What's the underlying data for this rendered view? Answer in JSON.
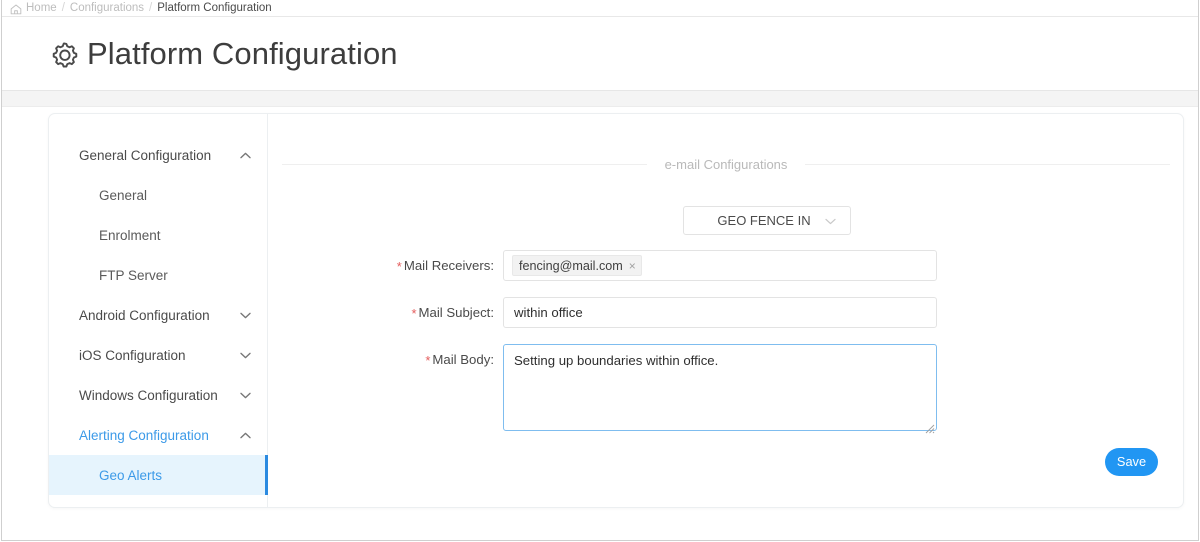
{
  "breadcrumb": {
    "home_icon": "home-icon",
    "items": [
      {
        "label": "Home",
        "current": false
      },
      {
        "label": "Configurations",
        "current": false
      },
      {
        "label": "Platform Configuration",
        "current": true
      }
    ],
    "separator": "/"
  },
  "header": {
    "icon": "gear-icon",
    "title": "Platform Configuration"
  },
  "sidebar": {
    "groups": [
      {
        "label": "General Configuration",
        "expanded": true,
        "chevron": "chevron-up-icon",
        "active": false,
        "children": [
          {
            "label": "General",
            "selected": false
          },
          {
            "label": "Enrolment",
            "selected": false
          },
          {
            "label": "FTP Server",
            "selected": false
          }
        ]
      },
      {
        "label": "Android Configuration",
        "expanded": false,
        "chevron": "chevron-down-icon",
        "active": false,
        "children": []
      },
      {
        "label": "iOS Configuration",
        "expanded": false,
        "chevron": "chevron-down-icon",
        "active": false,
        "children": []
      },
      {
        "label": "Windows Configuration",
        "expanded": false,
        "chevron": "chevron-down-icon",
        "active": false,
        "children": []
      },
      {
        "label": "Alerting Configuration",
        "expanded": true,
        "chevron": "chevron-up-icon",
        "active": true,
        "children": [
          {
            "label": "Geo Alerts",
            "selected": true
          }
        ]
      }
    ]
  },
  "form": {
    "section_title": "e-mail Configurations",
    "fence_select": {
      "value": "GEO FENCE IN",
      "caret_icon": "chevron-down-icon",
      "options": [
        "GEO FENCE IN"
      ]
    },
    "mail_receivers": {
      "label": "Mail Receivers:",
      "required_marker": "*",
      "tags": [
        {
          "value": "fencing@mail.com",
          "remove_icon": "close-icon",
          "remove_glyph": "×"
        }
      ],
      "placeholder": ""
    },
    "mail_subject": {
      "label": "Mail Subject:",
      "required_marker": "*",
      "value": "within office",
      "placeholder": ""
    },
    "mail_body": {
      "label": "Mail Body:",
      "required_marker": "*",
      "value": "Setting up boundaries within office.",
      "placeholder": "",
      "focused": true,
      "resize_handle_icon": "resize-grip-icon"
    },
    "save_button": {
      "label": "Save"
    }
  },
  "colors": {
    "accent_blue": "#2196f3",
    "link_blue": "#3c9ae8",
    "selected_bg": "#e6f4fd",
    "required_red": "#e45c5c",
    "focus_border": "#7fbdef",
    "text_dark": "#3d3d3d",
    "border_grey": "#e3e3e3",
    "band_grey": "#f4f4f4"
  }
}
